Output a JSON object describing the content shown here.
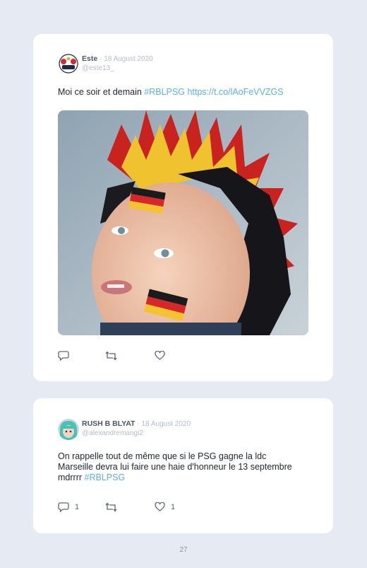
{
  "tweets": [
    {
      "author": "Este",
      "date": "· 18 August 2020",
      "handle": "@este13_",
      "text_plain": "Moi ce soir et demain ",
      "hashtag": "#RBLPSG",
      "link": "https://t.co/lAoFeVVZGS",
      "replies": "",
      "retweets": "",
      "likes": ""
    },
    {
      "author": "RUSH B BLYAT",
      "date": "· 18 August 2020",
      "handle": "@alexandremangi2",
      "line1": "On rappelle tout de même que si le PSG gagne la ldc",
      "line2": "Marseille devra lui faire une haie d'honneur le 13 septembre",
      "line3_plain": "mdrrrr ",
      "hashtag": "#RBLPSG",
      "replies": "1",
      "retweets": "",
      "likes": "1"
    }
  ],
  "page_number": "27",
  "colors": {
    "background": "#e6eaf3",
    "card": "#ffffff",
    "link": "#5ab0e6",
    "muted": "#b4bccb"
  },
  "icons": {
    "reply": "reply-icon",
    "retweet": "retweet-icon",
    "like": "heart-icon"
  }
}
